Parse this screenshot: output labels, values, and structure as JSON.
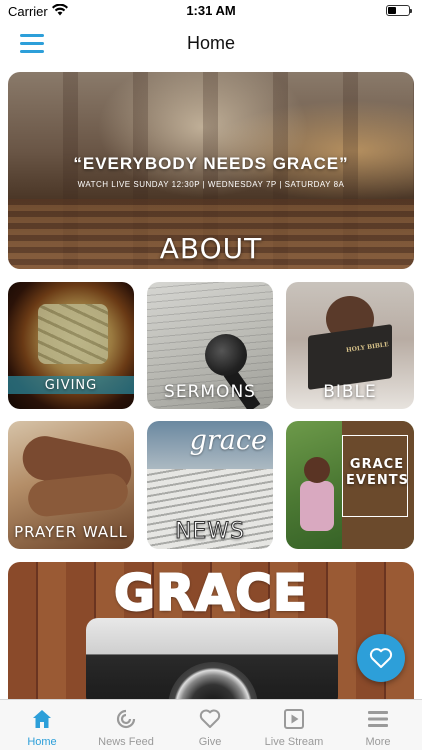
{
  "status_bar": {
    "carrier": "Carrier",
    "time": "1:31 AM"
  },
  "nav": {
    "title": "Home"
  },
  "tiles": {
    "about": {
      "quote": "“EVERYBODY NEEDS GRACE”",
      "subtitle": "WATCH LIVE SUNDAY 12:30P | WEDNESDAY 7P | SATURDAY 8A",
      "label": "ABOUT"
    },
    "giving": {
      "label": "GIVING"
    },
    "sermons": {
      "label": "SERMONS"
    },
    "bible": {
      "label": "BIBLE",
      "book_title": "HOLY BIBLE"
    },
    "prayer_wall": {
      "label": "PRAYER WALL"
    },
    "news": {
      "label": "NEWS",
      "script_text": "grace"
    },
    "grace_events": {
      "label_line1": "GRACE",
      "label_line2": "EVENTS"
    },
    "grace": {
      "label": "GRACE"
    }
  },
  "tab_bar": {
    "tabs": [
      {
        "label": "Home",
        "icon": "home-icon",
        "active": true
      },
      {
        "label": "News Feed",
        "icon": "news-feed-icon",
        "active": false
      },
      {
        "label": "Give",
        "icon": "heart-icon",
        "active": false
      },
      {
        "label": "Live Stream",
        "icon": "play-icon",
        "active": false
      },
      {
        "label": "More",
        "icon": "more-icon",
        "active": false
      }
    ]
  },
  "colors": {
    "accent": "#2d9fd9",
    "inactive": "#9a9a9a"
  }
}
